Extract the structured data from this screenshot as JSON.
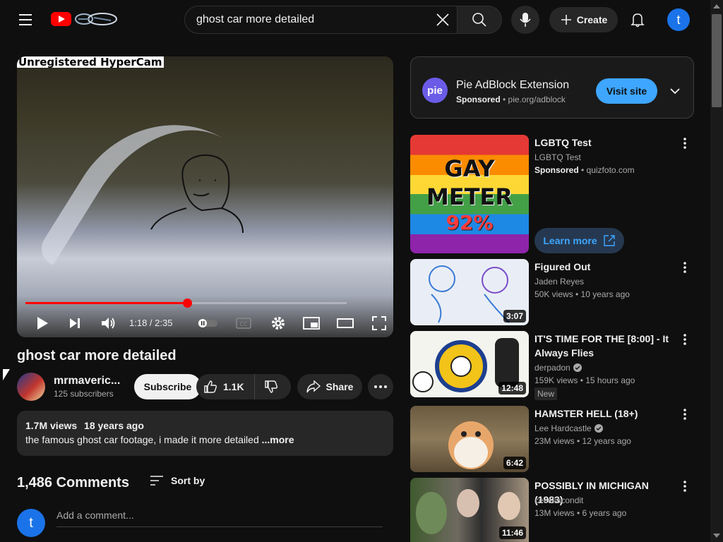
{
  "header": {
    "search_value": "ghost car more detailed",
    "create_label": "Create",
    "avatar_letter": "t",
    "icons": [
      "menu-icon",
      "youtube-logo-icon",
      "close-icon",
      "search-icon",
      "mic-icon",
      "plus-icon",
      "bell-icon"
    ]
  },
  "player": {
    "watermark": "Unregistered HyperCam",
    "time": "1:18 / 2:35",
    "progress_fraction": 0.503,
    "icons": [
      "play-icon",
      "next-icon",
      "volume-icon",
      "autoplay-toggle-icon",
      "captions-icon",
      "settings-icon",
      "miniplayer-icon",
      "theater-icon",
      "fullscreen-icon"
    ]
  },
  "video": {
    "title": "ghost car more detailed",
    "channel": "mrmaveric...",
    "subscribers": "125 subscribers",
    "subscribe_label": "Subscribe",
    "likes": "1.1K",
    "share_label": "Share",
    "views": "1.7M views",
    "age": "18 years ago",
    "description": "the famous ghost car footage, i made it more detailed ",
    "more_label": "...more"
  },
  "comments": {
    "count": "1,486 Comments",
    "sort_label": "Sort by",
    "avatar_letter": "t",
    "placeholder": "Add a comment..."
  },
  "ad": {
    "logo_text": "pie",
    "title": "Pie AdBlock Extension",
    "sponsored": "Sponsored",
    "domain": " • pie.org/adblock",
    "button": "Visit site"
  },
  "recommendations": [
    {
      "title": "LGBTQ Test",
      "channel": "LGBTQ Test",
      "sponsored": "Sponsored",
      "meta": " • quizfoto.com",
      "thumb_lines": [
        "GAY",
        "METER",
        "92%"
      ],
      "button": "Learn more"
    },
    {
      "title": "Figured Out",
      "channel": "Jaden Reyes",
      "meta": "50K views  • 10 years ago",
      "duration": "3:07"
    },
    {
      "title": "IT'S TIME FOR THE [8:00] - It Always Flies",
      "channel": "derpadon",
      "meta": "159K views  • 15 hours ago",
      "duration": "12:48",
      "badge": "New"
    },
    {
      "title": "HAMSTER HELL (18+)",
      "channel": "Lee Hardcastle",
      "meta": "23M views  • 12 years ago",
      "duration": "6:42"
    },
    {
      "title": "POSSIBLY IN MICHIGAN (1983)",
      "channel": "ceceliacondit",
      "meta": "13M views  • 6 years ago",
      "duration": "11:46"
    }
  ],
  "colors": {
    "background": "#0f0f0f",
    "accent_red": "#ff0000",
    "link_blue": "#3ea6ff",
    "avatar_blue": "#1a73e8"
  }
}
